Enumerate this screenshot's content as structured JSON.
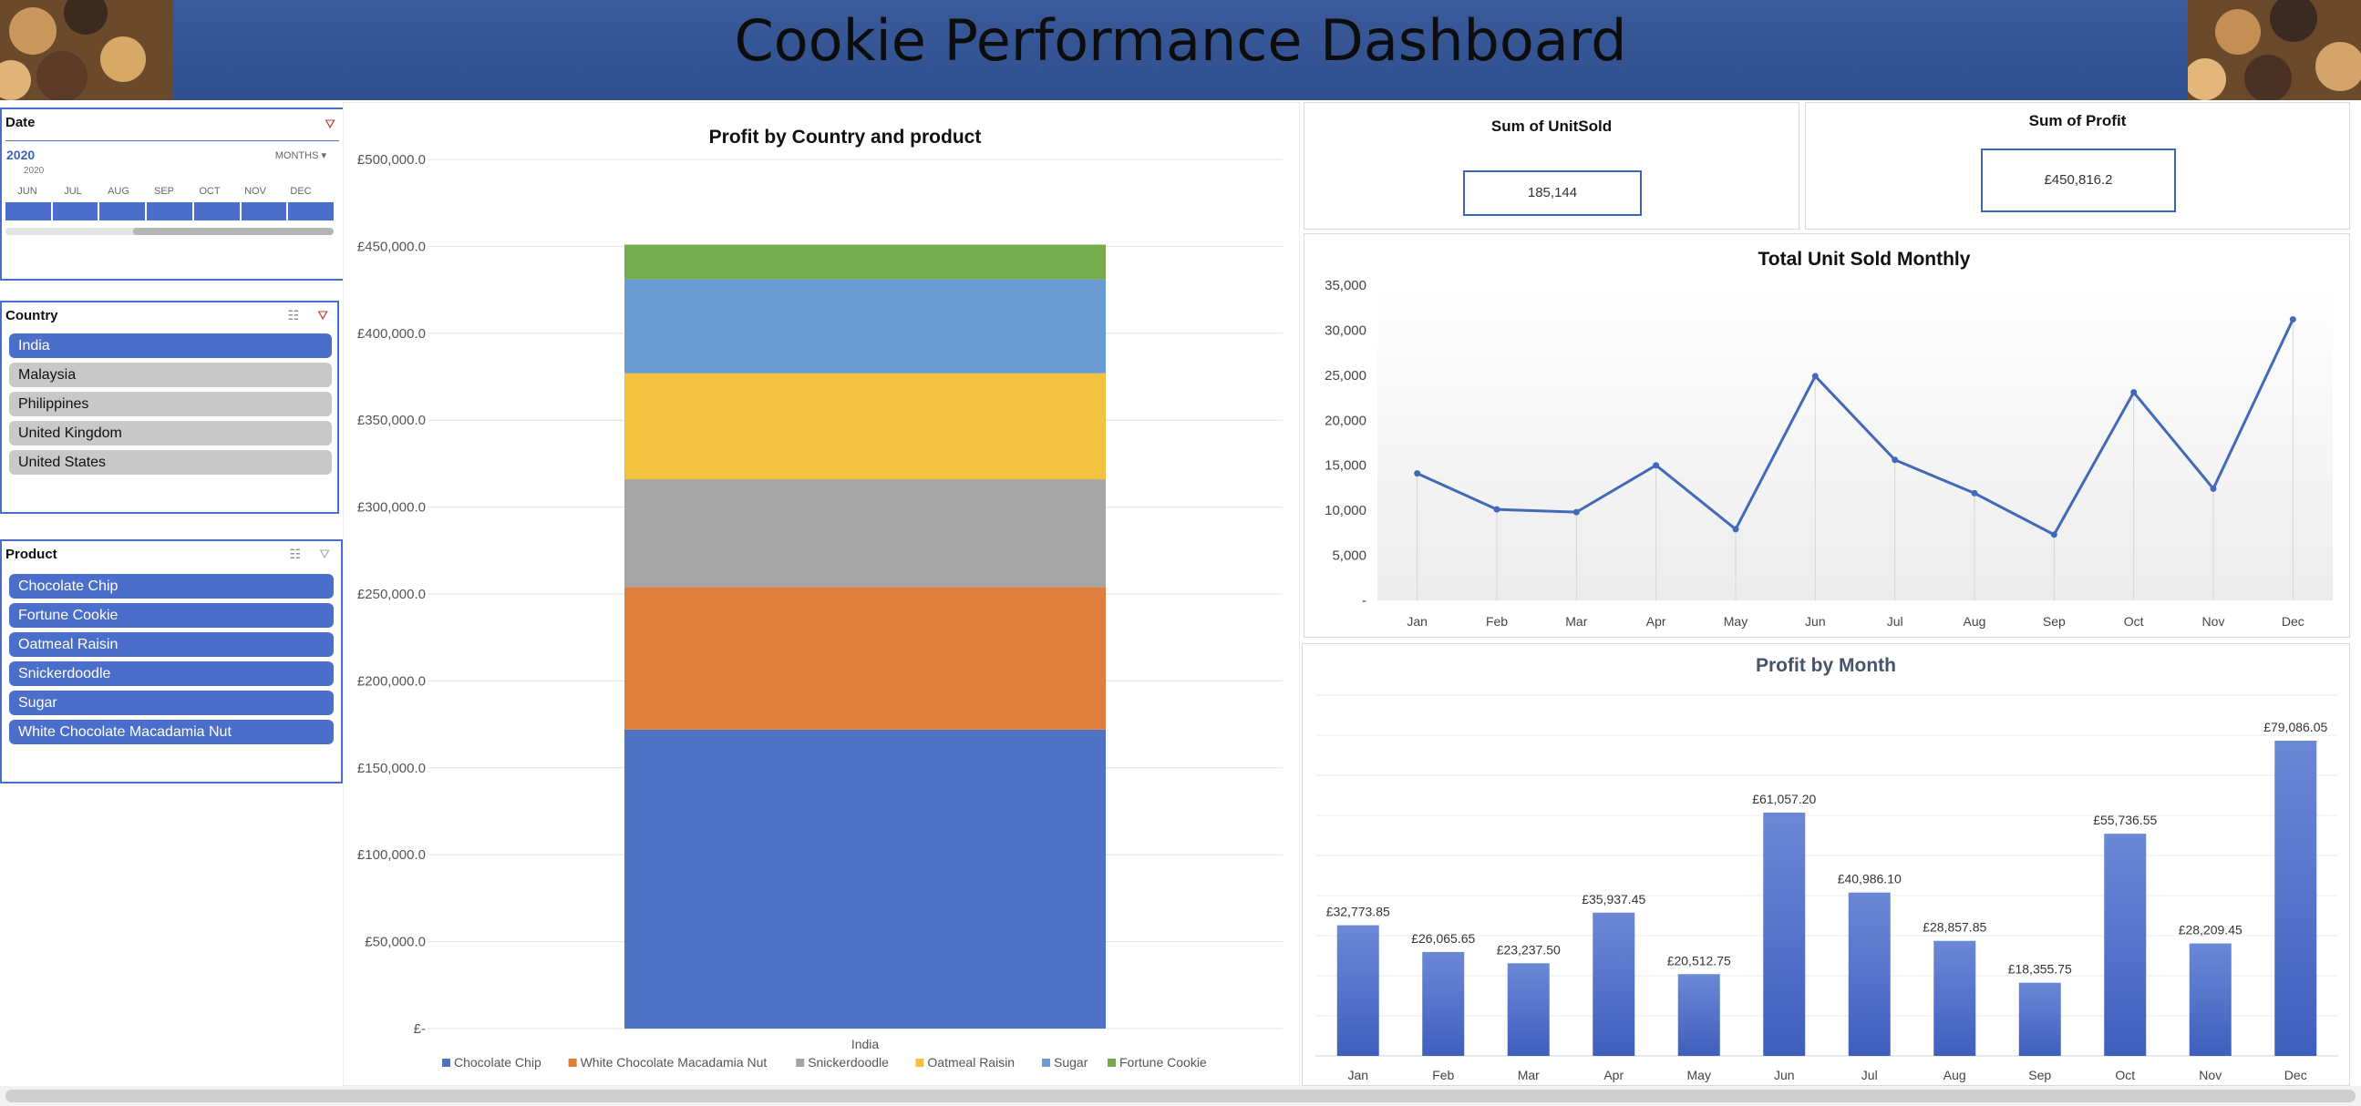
{
  "dashboard": {
    "title": "Cookie Performance Dashboard"
  },
  "date_slicer": {
    "title": "Date",
    "year": "2020",
    "level": "MONTHS",
    "sub_year": "2020",
    "months": [
      "JUN",
      "JUL",
      "AUG",
      "SEP",
      "OCT",
      "NOV",
      "DEC"
    ]
  },
  "country_slicer": {
    "title": "Country",
    "items": [
      {
        "label": "India",
        "selected": true
      },
      {
        "label": "Malaysia",
        "selected": false
      },
      {
        "label": "Philippines",
        "selected": false
      },
      {
        "label": "United Kingdom",
        "selected": false
      },
      {
        "label": "United States",
        "selected": false
      }
    ]
  },
  "product_slicer": {
    "title": "Product",
    "items": [
      {
        "label": "Chocolate Chip",
        "selected": true
      },
      {
        "label": "Fortune Cookie",
        "selected": true
      },
      {
        "label": "Oatmeal Raisin",
        "selected": true
      },
      {
        "label": "Snickerdoodle",
        "selected": true
      },
      {
        "label": "Sugar",
        "selected": true
      },
      {
        "label": "White Chocolate Macadamia Nut",
        "selected": true
      }
    ]
  },
  "kpis": {
    "units": {
      "title": "Sum of UnitSold",
      "value": "185,144"
    },
    "profit": {
      "title": "Sum of Profit",
      "value": "£450,816.2"
    }
  },
  "chart_data": [
    {
      "id": "profit-country-product",
      "type": "bar",
      "stacked": true,
      "title": "Profit by Country and product",
      "categories": [
        "India"
      ],
      "series": [
        {
          "name": "Chocolate Chip",
          "values": [
            172000
          ],
          "color": "#4e72c4"
        },
        {
          "name": "White Chocolate Macadamia Nut",
          "values": [
            82000
          ],
          "color": "#e07e3d"
        },
        {
          "name": "Snickerdoodle",
          "values": [
            62000
          ],
          "color": "#a5a5a5"
        },
        {
          "name": "Oatmeal Raisin",
          "values": [
            61000
          ],
          "color": "#f4c241"
        },
        {
          "name": "Sugar",
          "values": [
            54000
          ],
          "color": "#6a9bd3"
        },
        {
          "name": "Fortune Cookie",
          "values": [
            20000
          ],
          "color": "#76ab4d"
        }
      ],
      "ylim": [
        0,
        500000
      ],
      "yticks": [
        "£-",
        "£50,000.0",
        "£100,000.0",
        "£150,000.0",
        "£200,000.0",
        "£250,000.0",
        "£300,000.0",
        "£350,000.0",
        "£400,000.0",
        "£450,000.0",
        "£500,000.0"
      ],
      "legend": "bottom",
      "grid": true
    },
    {
      "id": "units-monthly",
      "type": "line",
      "title": "Total Unit Sold Monthly",
      "categories": [
        "Jan",
        "Feb",
        "Mar",
        "Apr",
        "May",
        "Jun",
        "Jul",
        "Aug",
        "Sep",
        "Oct",
        "Nov",
        "Dec"
      ],
      "values": [
        14100,
        10100,
        9800,
        15000,
        7900,
        24900,
        15600,
        11900,
        7300,
        23100,
        12400,
        31200
      ],
      "color": "#4468b8",
      "ylim": [
        0,
        35000
      ],
      "yticks": [
        "-",
        "5,000",
        "10,000",
        "15,000",
        "20,000",
        "25,000",
        "30,000",
        "35,000"
      ],
      "grid": false
    },
    {
      "id": "profit-by-month",
      "type": "bar",
      "title": "Profit by Month",
      "categories": [
        "Jan",
        "Feb",
        "Mar",
        "Apr",
        "May",
        "Jun",
        "Jul",
        "Aug",
        "Sep",
        "Oct",
        "Nov",
        "Dec"
      ],
      "values": [
        32773.85,
        26065.65,
        23237.5,
        35937.45,
        20512.75,
        61057.2,
        40986.1,
        28857.85,
        18355.75,
        55736.55,
        28209.45,
        79086.05
      ],
      "labels": [
        "£32,773.85",
        "£26,065.65",
        "£23,237.50",
        "£35,937.45",
        "£20,512.75",
        "£61,057.20",
        "£40,986.10",
        "£28,857.85",
        "£18,355.75",
        "£55,736.55",
        "£28,209.45",
        "£79,086.05"
      ],
      "color": "#4468c4",
      "grid": true
    }
  ]
}
